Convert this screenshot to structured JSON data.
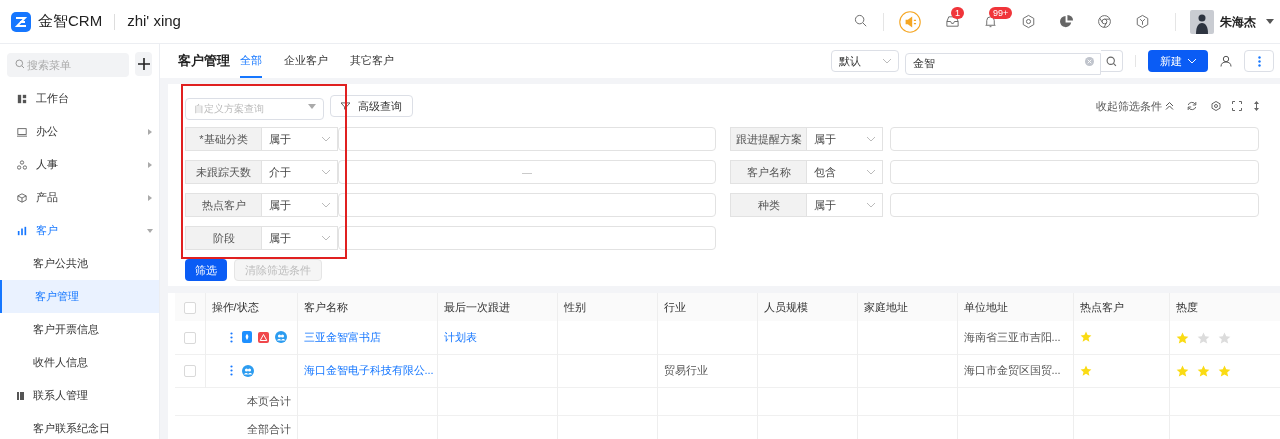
{
  "header": {
    "product": "金智CRM",
    "workspace": "zhi' xing",
    "icons": [
      {
        "kind": "search"
      },
      {
        "kind": "megaphone"
      },
      {
        "kind": "inbox",
        "badge": "1"
      },
      {
        "kind": "bell",
        "badge": "99+"
      },
      {
        "kind": "gear"
      },
      {
        "kind": "pie"
      },
      {
        "kind": "browser"
      },
      {
        "kind": "hexagon"
      }
    ],
    "user": {
      "name": "朱海杰"
    }
  },
  "sidebar": {
    "search_placeholder": "搜索菜单",
    "items": [
      {
        "label": "工作台",
        "kind": "link",
        "selected": false
      },
      {
        "label": "办公",
        "kind": "group",
        "expanded": false
      },
      {
        "label": "人事",
        "kind": "group",
        "expanded": false
      },
      {
        "label": "产品",
        "kind": "group",
        "expanded": false
      },
      {
        "label": "客户",
        "kind": "group",
        "expanded": true,
        "children": [
          {
            "label": "客户公共池",
            "kind": "plain",
            "selected": false
          },
          {
            "label": "客户管理",
            "kind": "plain",
            "selected": true
          },
          {
            "label": "客户开票信息",
            "kind": "plain",
            "selected": false
          },
          {
            "label": "收件人信息",
            "kind": "plain",
            "selected": false
          },
          {
            "label": "联系人管理",
            "kind": "icon",
            "selected": false
          },
          {
            "label": "客户联系纪念日",
            "kind": "plain",
            "selected": false
          }
        ]
      }
    ]
  },
  "page": {
    "title": "客户管理",
    "tabs": [
      {
        "label": "全部",
        "selected": true
      },
      {
        "label": "企业客户",
        "selected": false
      },
      {
        "label": "其它客户",
        "selected": false
      }
    ],
    "scope": "默认",
    "search_value": "金智",
    "new_button": "新建"
  },
  "filter": {
    "scheme_placeholder": "自定义方案查询",
    "advanced": "高级查询",
    "collapse": "收起筛选条件",
    "left": [
      {
        "label": "*基础分类",
        "op": "属于"
      },
      {
        "label": "未跟踪天数",
        "op": "介于",
        "separator": "—"
      },
      {
        "label": "热点客户",
        "op": "属于"
      },
      {
        "label": "阶段",
        "op": "属于"
      }
    ],
    "right": [
      {
        "label": "跟进提醒方案",
        "op": "属于"
      },
      {
        "label": "客户名称",
        "op": "包含"
      },
      {
        "label": "种类",
        "op": "属于"
      }
    ],
    "apply": "筛选",
    "clear": {
      "label": "清除筛选条件",
      "disabled": true
    }
  },
  "table": {
    "header_checked": false,
    "columns": [
      "操作/状态",
      "客户名称",
      "最后一次跟进",
      "性别",
      "行业",
      "人员规模",
      "家庭地址",
      "单位地址",
      "热点客户",
      "热度"
    ],
    "rows": [
      {
        "checked": false,
        "status_icons": [
          {
            "kind": "document"
          },
          {
            "kind": "warning"
          },
          {
            "kind": "group"
          }
        ],
        "name": "三亚金智富书店",
        "last_follow_up": "计划表",
        "work_address": "海南省三亚市吉阳...",
        "hot": true,
        "stars": 1
      },
      {
        "checked": false,
        "status_icons": [
          {
            "kind": "group"
          }
        ],
        "name": "海口金智电子科技有限公...",
        "industry": "贸易行业",
        "work_address": "海口市金贸区国贸...",
        "hot": true,
        "stars": 3
      }
    ],
    "totals": [
      "本页合计",
      "全部合计"
    ]
  }
}
